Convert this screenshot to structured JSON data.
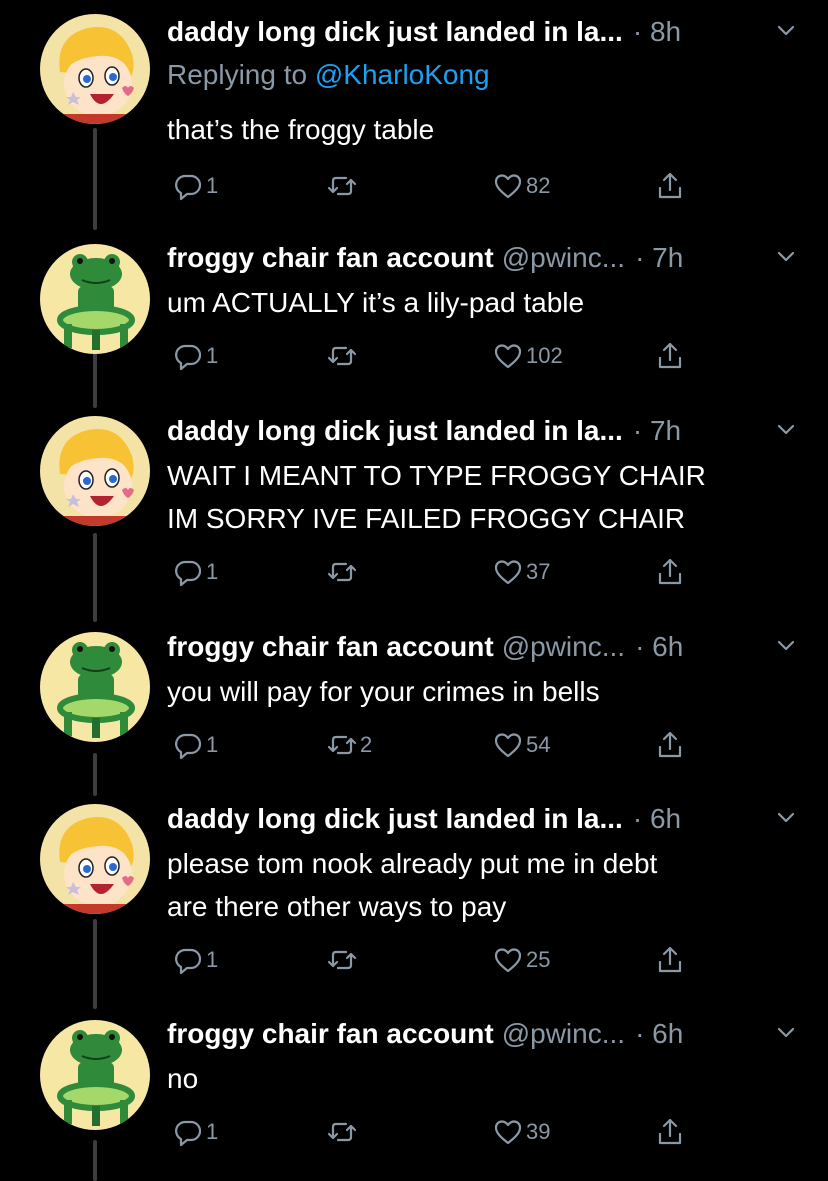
{
  "thread": [
    {
      "avatar": "cartoon-boy-avatar",
      "name": "daddy long dick just landed in la...",
      "handle": "",
      "time": "· 8h",
      "replying_label": "Replying to",
      "replying_to": "@KharloKong",
      "lines": [
        "that’s the froggy table"
      ],
      "replies": "1",
      "retweets": "",
      "likes": "82"
    },
    {
      "avatar": "froggy-chair-avatar",
      "name": "froggy chair fan account",
      "handle": "@pwinc...",
      "time": "· 7h",
      "lines": [
        "um ACTUALLY it’s a lily-pad table"
      ],
      "replies": "1",
      "retweets": "",
      "likes": "102"
    },
    {
      "avatar": "cartoon-boy-avatar",
      "name": "daddy long dick just landed in la...",
      "handle": "",
      "time": "· 7h",
      "lines": [
        "WAIT I MEANT TO TYPE FROGGY CHAIR",
        "IM SORRY IVE FAILED FROGGY CHAIR"
      ],
      "replies": "1",
      "retweets": "",
      "likes": "37"
    },
    {
      "avatar": "froggy-chair-avatar",
      "name": "froggy chair fan account",
      "handle": "@pwinc...",
      "time": "· 6h",
      "lines": [
        "you will pay for your crimes in bells"
      ],
      "replies": "1",
      "retweets": "2",
      "likes": "54"
    },
    {
      "avatar": "cartoon-boy-avatar",
      "name": "daddy long dick just landed in la...",
      "handle": "",
      "time": "· 6h",
      "lines": [
        "please tom nook already put me in debt",
        "are there other ways to pay"
      ],
      "replies": "1",
      "retweets": "",
      "likes": "25"
    },
    {
      "avatar": "froggy-chair-avatar",
      "name": "froggy chair fan account",
      "handle": "@pwinc...",
      "time": "· 6h",
      "lines": [
        "no"
      ],
      "replies": "1",
      "retweets": "",
      "likes": "39"
    }
  ],
  "colors": {
    "background": "#000000",
    "text": "#ffffff",
    "secondary": "#8b98a5",
    "link": "#1da1f2",
    "thread_line": "#3a3d41",
    "avatar_bg": "#f7e7a4"
  },
  "icons": {
    "reply": "reply-icon",
    "retweet": "retweet-icon",
    "like": "heart-icon",
    "share": "share-icon",
    "menu": "chevron-down-icon"
  }
}
